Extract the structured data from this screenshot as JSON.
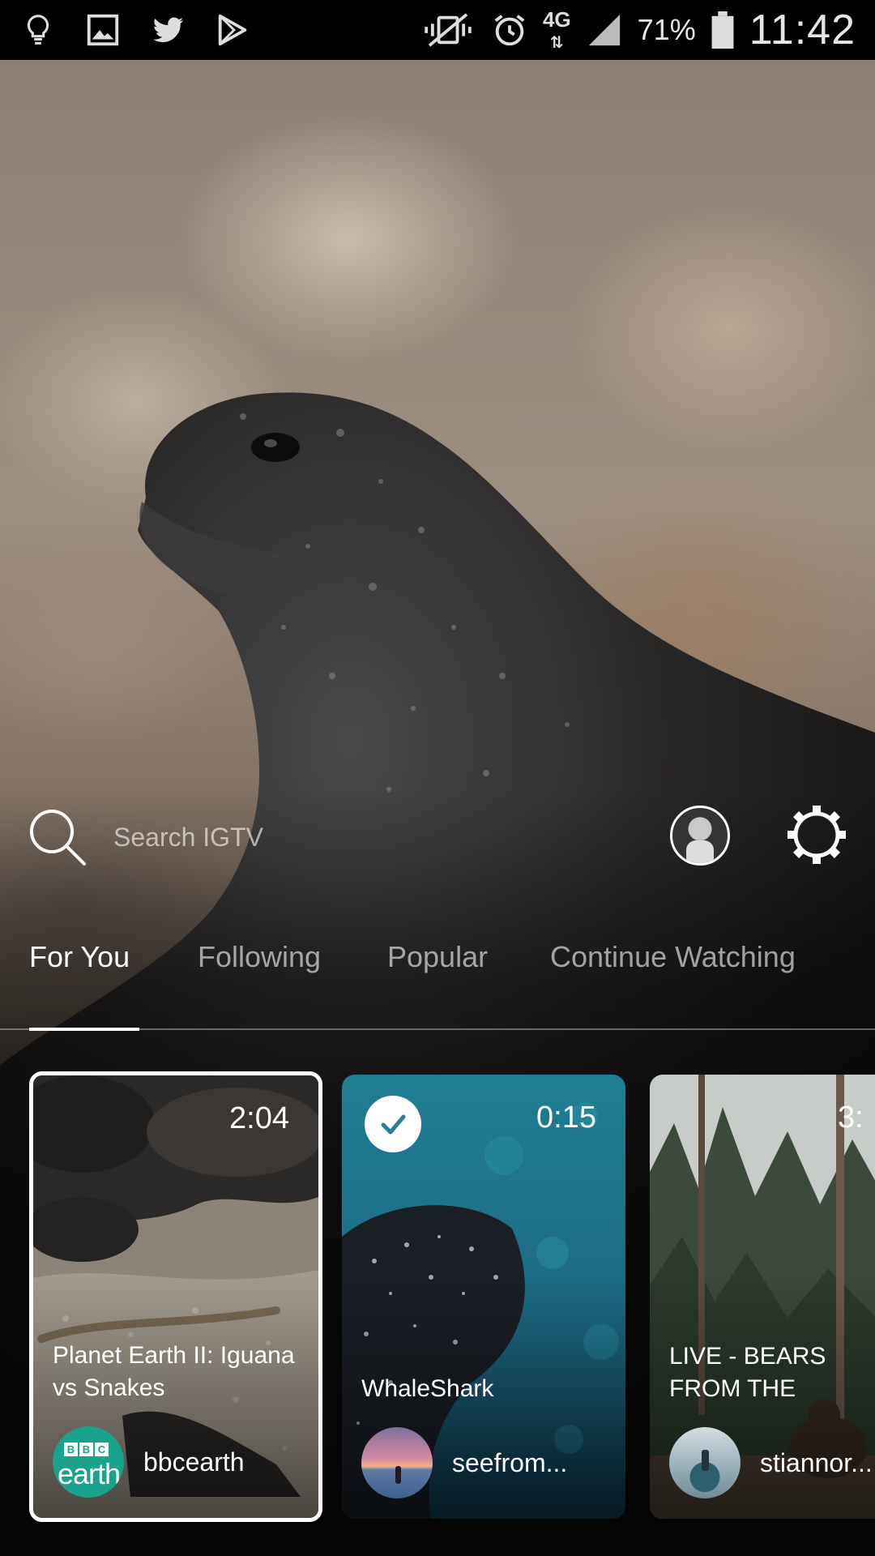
{
  "status_bar": {
    "left_icons": [
      "lightbulb-icon",
      "image-icon",
      "twitter-icon",
      "play-store-icon"
    ],
    "right_icons": [
      "vibrate-mute-icon",
      "alarm-icon",
      "signal-icon",
      "battery-icon"
    ],
    "network": "4G",
    "battery": "71%",
    "time": "11:42"
  },
  "search": {
    "placeholder": "Search IGTV"
  },
  "tabs": [
    {
      "label": "For You",
      "active": true
    },
    {
      "label": "Following",
      "active": false
    },
    {
      "label": "Popular",
      "active": false
    },
    {
      "label": "Continue Watching",
      "active": false
    }
  ],
  "cards": [
    {
      "duration": "2:04",
      "title": "Planet Earth II: Iguana vs Snakes",
      "owner": "bbcearth",
      "avatar_logo": {
        "letters": [
          "B",
          "B",
          "C"
        ],
        "word": "earth"
      },
      "selected": true,
      "watched": false
    },
    {
      "duration": "0:15",
      "title": "WhaleShark",
      "owner": "seefrom...",
      "selected": false,
      "watched": true
    },
    {
      "duration": "3:",
      "title": "LIVE - BEARS FROM THE",
      "owner": "stiannor...",
      "selected": false,
      "watched": false
    }
  ],
  "colors": {
    "status_bar_bg": "#000000",
    "text_primary": "#ffffff",
    "text_inactive": "rgba(255,255,255,0.6)",
    "bbc_earth_teal": "#1aa38c"
  }
}
